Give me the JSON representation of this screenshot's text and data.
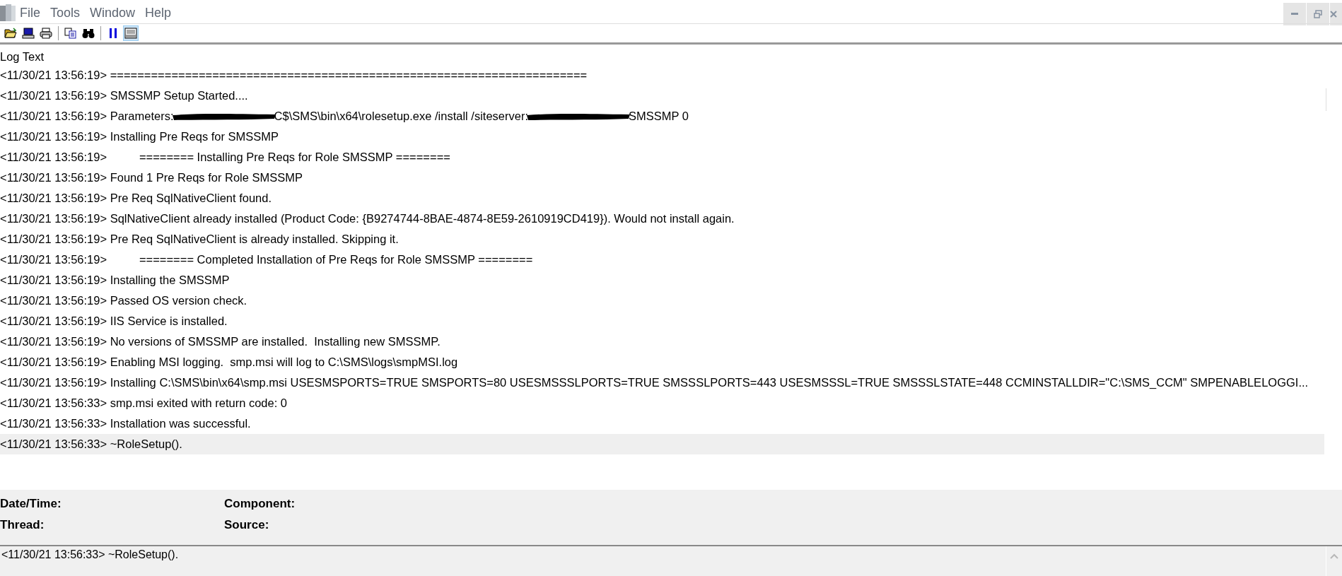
{
  "menu": [
    "File",
    "Tools",
    "Window",
    "Help"
  ],
  "toolbar": [
    {
      "kind": "open",
      "pressed": false
    },
    {
      "kind": "computer",
      "pressed": false
    },
    {
      "kind": "print",
      "pressed": false
    },
    {
      "kind": "sep"
    },
    {
      "kind": "copy",
      "pressed": false
    },
    {
      "kind": "find",
      "pressed": false
    },
    {
      "kind": "sep"
    },
    {
      "kind": "pause",
      "pressed": false
    },
    {
      "kind": "view",
      "pressed": true
    }
  ],
  "log": {
    "header": "Log Text",
    "rows": [
      {
        "parts": [
          {
            "kind": "text",
            "text": "<11/30/21 13:56:19> ======================================================================"
          }
        ],
        "selected": false
      },
      {
        "parts": [
          {
            "kind": "text",
            "text": "<11/30/21 13:56:19> SMSSMP Setup Started...."
          }
        ],
        "selected": false
      },
      {
        "parts": [
          {
            "kind": "text",
            "text": "<11/30/21 13:56:19> Parameters:"
          },
          {
            "kind": "redacted"
          },
          {
            "kind": "text",
            "text": "C$\\SMS\\bin\\x64\\rolesetup.exe /install /siteserver:"
          },
          {
            "kind": "redacted"
          },
          {
            "kind": "text",
            "text": "SMSSMP 0"
          }
        ],
        "selected": false
      },
      {
        "parts": [
          {
            "kind": "text",
            "text": "<11/30/21 13:56:19> Installing Pre Reqs for SMSSMP"
          }
        ],
        "selected": false
      },
      {
        "parts": [
          {
            "kind": "text",
            "text": "<11/30/21 13:56:19>          ======== Installing Pre Reqs for Role SMSSMP ========"
          }
        ],
        "selected": false
      },
      {
        "parts": [
          {
            "kind": "text",
            "text": "<11/30/21 13:56:19> Found 1 Pre Reqs for Role SMSSMP"
          }
        ],
        "selected": false
      },
      {
        "parts": [
          {
            "kind": "text",
            "text": "<11/30/21 13:56:19> Pre Req SqlNativeClient found."
          }
        ],
        "selected": false
      },
      {
        "parts": [
          {
            "kind": "text",
            "text": "<11/30/21 13:56:19> SqlNativeClient already installed (Product Code: {B9274744-8BAE-4874-8E59-2610919CD419}). Would not install again."
          }
        ],
        "selected": false
      },
      {
        "parts": [
          {
            "kind": "text",
            "text": "<11/30/21 13:56:19> Pre Req SqlNativeClient is already installed. Skipping it."
          }
        ],
        "selected": false
      },
      {
        "parts": [
          {
            "kind": "text",
            "text": "<11/30/21 13:56:19>          ======== Completed Installation of Pre Reqs for Role SMSSMP ========"
          }
        ],
        "selected": false
      },
      {
        "parts": [
          {
            "kind": "text",
            "text": "<11/30/21 13:56:19> Installing the SMSSMP"
          }
        ],
        "selected": false
      },
      {
        "parts": [
          {
            "kind": "text",
            "text": "<11/30/21 13:56:19> Passed OS version check."
          }
        ],
        "selected": false
      },
      {
        "parts": [
          {
            "kind": "text",
            "text": "<11/30/21 13:56:19> IIS Service is installed."
          }
        ],
        "selected": false
      },
      {
        "parts": [
          {
            "kind": "text",
            "text": "<11/30/21 13:56:19> No versions of SMSSMP are installed.  Installing new SMSSMP."
          }
        ],
        "selected": false
      },
      {
        "parts": [
          {
            "kind": "text",
            "text": "<11/30/21 13:56:19> Enabling MSI logging.  smp.msi will log to C:\\SMS\\logs\\smpMSI.log"
          }
        ],
        "selected": false
      },
      {
        "parts": [
          {
            "kind": "text",
            "text": "<11/30/21 13:56:19> Installing C:\\SMS\\bin\\x64\\smp.msi USESMSPORTS=TRUE SMSPORTS=80 USESMSSSLPORTS=TRUE SMSSSLPORTS=443 USESMSSSL=TRUE SMSSSLSTATE=448 CCMINSTALLDIR=\"C:\\SMS_CCM\" SMPENABLELOGGI..."
          }
        ],
        "selected": false
      },
      {
        "parts": [
          {
            "kind": "text",
            "text": "<11/30/21 13:56:33> smp.msi exited with return code: 0"
          }
        ],
        "selected": false
      },
      {
        "parts": [
          {
            "kind": "text",
            "text": "<11/30/21 13:56:33> Installation was successful."
          }
        ],
        "selected": false
      },
      {
        "parts": [
          {
            "kind": "text",
            "text": "<11/30/21 13:56:33> ~RoleSetup()."
          }
        ],
        "selected": true
      }
    ]
  },
  "details": {
    "labels": [
      "Date/Time:",
      "Component:",
      "Thread:",
      "Source:"
    ],
    "message": "<11/30/21 13:56:33> ~RoleSetup()."
  }
}
